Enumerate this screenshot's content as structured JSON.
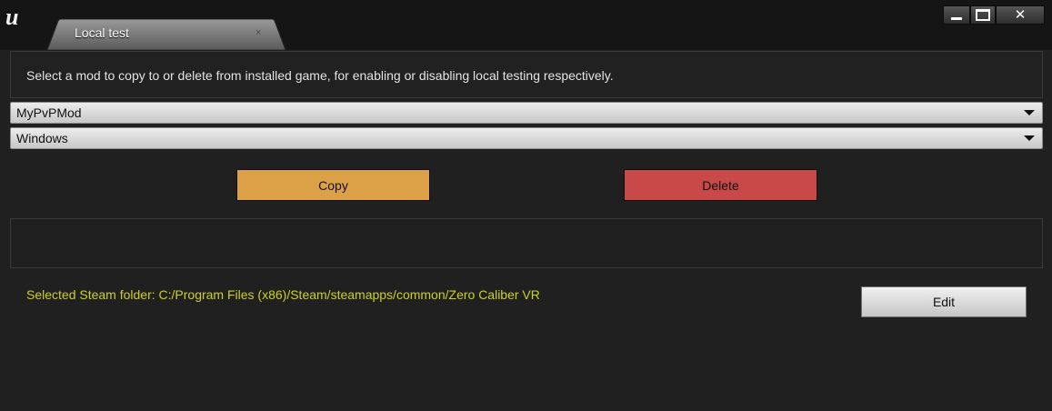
{
  "app": {
    "logo_glyph": "u",
    "tab_title": "Local test",
    "tab_close_glyph": "×"
  },
  "window_controls": {
    "minimize_icon": "minimize-icon",
    "maximize_icon": "maximize-icon",
    "close_icon": "close-icon",
    "close_glyph": "✕"
  },
  "instructions": "Select a mod to copy to or delete from installed game, for enabling or disabling local testing respectively.",
  "mod_select": {
    "value": "MyPvPMod"
  },
  "platform_select": {
    "value": "Windows"
  },
  "buttons": {
    "copy": "Copy",
    "delete": "Delete",
    "edit": "Edit"
  },
  "log_output": "",
  "steam_folder": "Selected Steam folder: C:/Program Files (x86)/Steam/steamapps/common/Zero Caliber VR",
  "colors": {
    "copy_button": "#dca046",
    "delete_button": "#c94848",
    "folder_text": "#cfcf24",
    "background": "#202020"
  }
}
